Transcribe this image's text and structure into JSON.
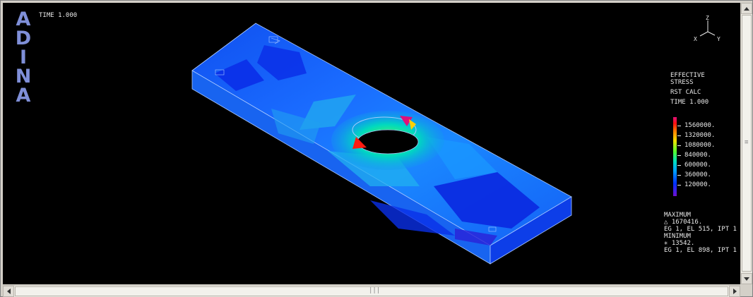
{
  "logo": {
    "letters": [
      "A",
      "D",
      "I",
      "N",
      "A"
    ]
  },
  "time_label": "TIME 1.000",
  "axes": {
    "z": "Z",
    "x": "X",
    "y": "Y"
  },
  "legend": {
    "title_lines": [
      "EFFECTIVE",
      "STRESS",
      "RST CALC",
      "TIME 1.000"
    ],
    "ticks": [
      "1560000.",
      "1320000.",
      "1080000.",
      "840000.",
      "600000.",
      "360000.",
      "120000."
    ]
  },
  "extrema": {
    "max_label": "MAXIMUM",
    "max_value": "△ 1670416.",
    "max_location": "EG 1, EL 515, IPT 1",
    "min_label": "MINIMUM",
    "min_value": "✳ 13542.",
    "min_location": "EG 1, EL 898, IPT 1"
  },
  "colors": {
    "background": "#000000",
    "logo": "#7f8fd8",
    "mesh_low": "#0a2fe8",
    "mesh_mid": "#1a80ff",
    "mesh_high": "#ff1010"
  },
  "icons": {
    "up": "scroll-up-arrow-icon",
    "down": "scroll-down-arrow-icon",
    "left": "scroll-left-arrow-icon",
    "right": "scroll-right-arrow-icon"
  }
}
